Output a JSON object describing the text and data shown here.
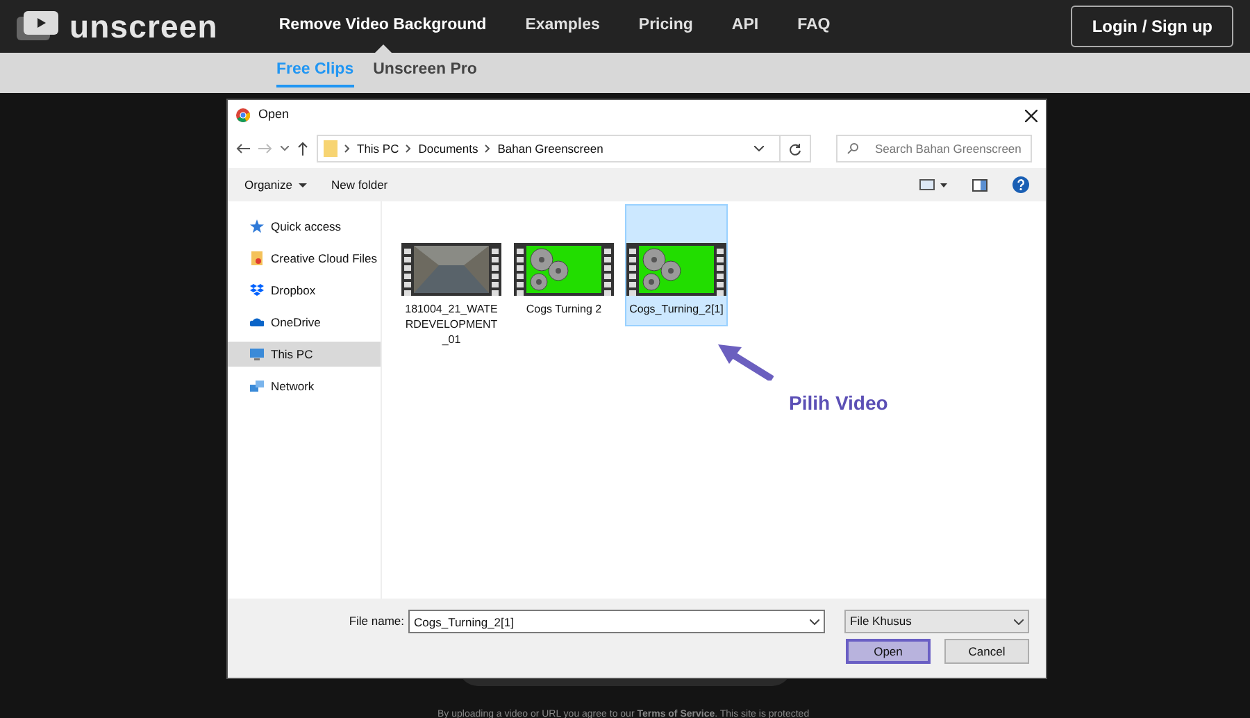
{
  "header": {
    "logo": "unscreen",
    "nav": [
      {
        "label": "Remove Video Background",
        "selected": true
      },
      {
        "label": "Examples",
        "selected": false
      },
      {
        "label": "Pricing",
        "selected": false
      },
      {
        "label": "API",
        "selected": false
      },
      {
        "label": "FAQ",
        "selected": false
      }
    ],
    "login": "Login / Sign up"
  },
  "subnav": [
    {
      "label": "Free Clips",
      "selected": true
    },
    {
      "label": "Unscreen Pro",
      "selected": false
    }
  ],
  "dialog": {
    "title": "Open",
    "breadcrumb": [
      "This PC",
      "Documents",
      "Bahan Greenscreen"
    ],
    "search": {
      "placeholder": "Search Bahan Greenscreen"
    },
    "toolbar": [
      {
        "label": "Organize",
        "kind": "menu"
      },
      {
        "label": "New folder",
        "kind": "button"
      }
    ],
    "sidebar": [
      {
        "label": "Quick access",
        "kind": "star",
        "selected": false
      },
      {
        "label": "Creative Cloud Files",
        "kind": "cloudfiles",
        "selected": false
      },
      {
        "label": "Dropbox",
        "kind": "dropbox",
        "selected": false
      },
      {
        "label": "OneDrive",
        "kind": "onedrive",
        "selected": false
      },
      {
        "label": "This PC",
        "kind": "pc",
        "selected": true
      },
      {
        "label": "Network",
        "kind": "network",
        "selected": false
      }
    ],
    "files": [
      {
        "name": "181004_21_WATERDEVELOPMENT_01",
        "kind": "photo",
        "selected": false
      },
      {
        "name": "Cogs Turning 2",
        "kind": "cogs",
        "selected": false
      },
      {
        "name": "Cogs_Turning_2[1]",
        "kind": "cogs",
        "selected": true
      }
    ],
    "file_name": {
      "label": "File name:",
      "value": "Cogs_Turning_2[1]"
    },
    "file_type": "File Khusus",
    "buttons": [
      {
        "label": "Open",
        "kind": "primary"
      },
      {
        "label": "Cancel",
        "kind": "secondary"
      }
    ]
  },
  "annotation": "Pilih Video",
  "footer": "By uploading a video or URL you agree to our **Terms of Service**. This site is protected"
}
